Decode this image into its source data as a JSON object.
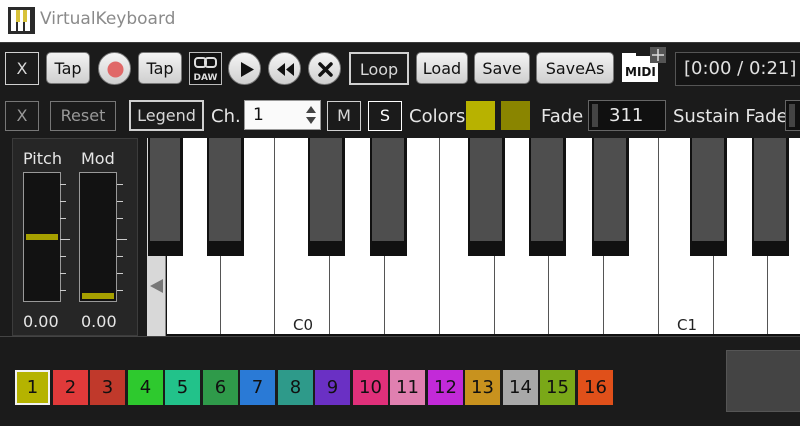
{
  "app": {
    "title": "VirtualKeyboard"
  },
  "toolbar": {
    "close_label": "X",
    "tap1_label": "Tap",
    "tap2_label": "Tap",
    "daw_label": "DAW",
    "loop_label": "Loop",
    "load_label": "Load",
    "save_label": "Save",
    "saveas_label": "SaveAs",
    "midi_label": "MIDI",
    "time_display": "[0:00 / 0:21] :"
  },
  "controls": {
    "close_label": "X",
    "reset_label": "Reset",
    "legend_label": "Legend",
    "channel_label": "Ch.",
    "channel_value": "1",
    "mute_label": "M",
    "solo_label": "S",
    "colors_label": "Colors",
    "color1": "#b8b200",
    "color2": "#8a8500",
    "fade_label": "Fade",
    "fade_value": "311",
    "sustain_fade_label": "Sustain Fade"
  },
  "wheels": {
    "pitch_label": "Pitch",
    "pitch_value": "0.00",
    "pitch_level": 0.5,
    "mod_label": "Mod",
    "mod_value": "0.00",
    "mod_level": 0.0
  },
  "keyboard": {
    "labels": [
      "C0",
      "C1"
    ]
  },
  "channels": [
    {
      "label": "1",
      "color": "#b5b300",
      "active": true
    },
    {
      "label": "2",
      "color": "#e03a3a",
      "active": false
    },
    {
      "label": "3",
      "color": "#c0392b",
      "active": false
    },
    {
      "label": "4",
      "color": "#2ec92e",
      "active": false
    },
    {
      "label": "5",
      "color": "#22c28a",
      "active": false
    },
    {
      "label": "6",
      "color": "#2f9a4a",
      "active": false
    },
    {
      "label": "7",
      "color": "#2a7ad6",
      "active": false
    },
    {
      "label": "8",
      "color": "#2e9a8a",
      "active": false
    },
    {
      "label": "9",
      "color": "#6a30c4",
      "active": false
    },
    {
      "label": "10",
      "color": "#e0307a",
      "active": false
    },
    {
      "label": "11",
      "color": "#e080b0",
      "active": false
    },
    {
      "label": "12",
      "color": "#c22ad8",
      "active": false
    },
    {
      "label": "13",
      "color": "#c8921e",
      "active": false
    },
    {
      "label": "14",
      "color": "#a8a8a8",
      "active": false
    },
    {
      "label": "15",
      "color": "#7aa818",
      "active": false
    },
    {
      "label": "16",
      "color": "#e0501a",
      "active": false
    }
  ]
}
